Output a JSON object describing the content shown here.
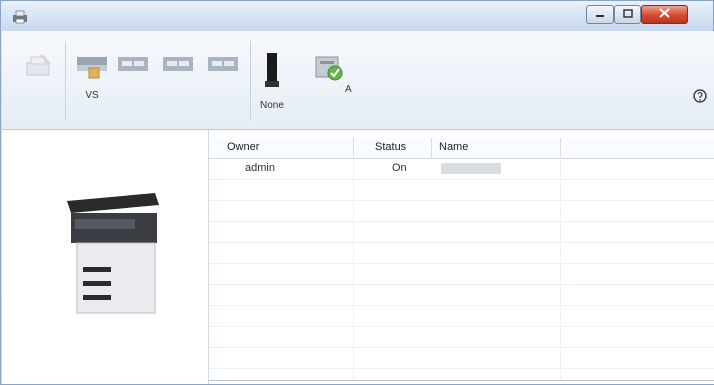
{
  "window": {
    "title": "",
    "app_icon": "printer-app-icon"
  },
  "title_buttons": {
    "minimize_icon": "minimize-icon",
    "maximize_icon": "maximize-icon",
    "close_icon": "close-icon"
  },
  "toolbar": {
    "tools": [
      {
        "icon": "scan-disabled-icon",
        "label": ""
      },
      {
        "icon": "document-box-icon",
        "label": "VS"
      },
      {
        "icon": "tray-1-icon",
        "label": ""
      },
      {
        "icon": "tray-2-icon",
        "label": ""
      },
      {
        "icon": "tray-3-icon",
        "label": ""
      },
      {
        "icon": "toner-cartridge-icon",
        "label": "None"
      },
      {
        "icon": "checkmark-document-icon",
        "label": "A"
      }
    ],
    "help_icon": "help-icon"
  },
  "device": {
    "image": "printer-device-image"
  },
  "job_list": {
    "columns": [
      "Owner",
      "Status",
      "Name"
    ],
    "rows": [
      {
        "owner": "admin",
        "status": "On",
        "name": ""
      }
    ]
  }
}
